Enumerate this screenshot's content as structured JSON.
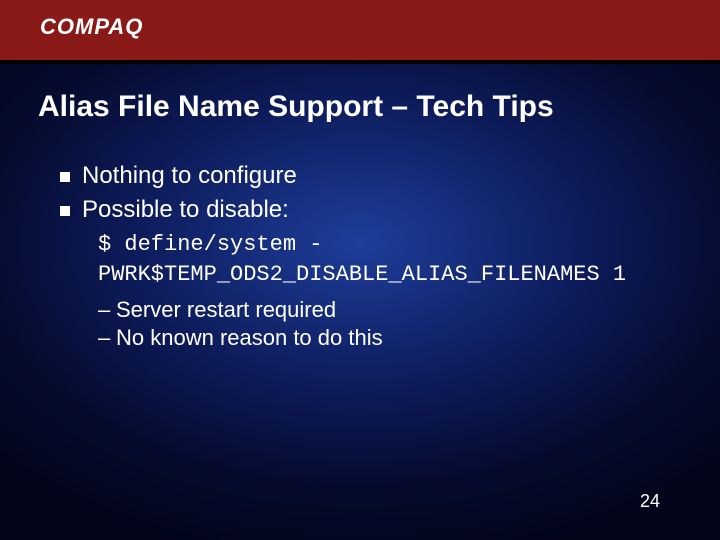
{
  "header": {
    "logo_text": "COMPAQ"
  },
  "title": "Alias File Name Support – Tech Tips",
  "bullets": [
    "Nothing to configure",
    "Possible to disable:"
  ],
  "code": {
    "line1": "$ define/system -",
    "line2": "PWRK$TEMP_ODS2_DISABLE_ALIAS_FILENAMES 1"
  },
  "sub_bullets": [
    "Server restart required",
    "No known reason to do this"
  ],
  "page_number": "24"
}
